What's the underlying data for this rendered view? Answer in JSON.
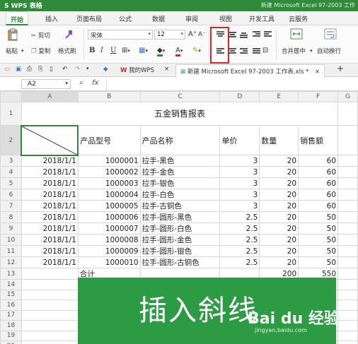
{
  "window": {
    "app_label": "S WPS 表格",
    "doc_title": "新建 Microsoft Excel 97-2003 工作"
  },
  "ribbon_tabs": [
    "开始",
    "插入",
    "页面布局",
    "公式",
    "数据",
    "审阅",
    "视图",
    "开发工具",
    "云服务"
  ],
  "ribbon": {
    "paste": "粘贴",
    "cut": "剪切",
    "copy": "复制",
    "format_painter": "格式刷",
    "font_name": "宋体",
    "font_size": "12",
    "merge_center": "合并居中",
    "wrap_text": "自动换行"
  },
  "doc_tabs": {
    "home": "我的WPS",
    "active": "新建 Microsoft Excel 97-2003 工作表.xls *"
  },
  "formula_bar": {
    "name_box": "A2",
    "fx": "fx"
  },
  "columns": [
    "A",
    "B",
    "C",
    "D",
    "E",
    "F"
  ],
  "sheet": {
    "title": "五金销售报表",
    "headers": [
      "产品型号",
      "产品名称",
      "单价",
      "数量",
      "销售额"
    ],
    "rows": [
      [
        "2018/1/1",
        "1000001",
        "拉手-黑色",
        "3",
        "20",
        "60"
      ],
      [
        "2018/1/1",
        "1000002",
        "拉手-金色",
        "3",
        "20",
        "60"
      ],
      [
        "2018/1/1",
        "1000003",
        "拉手-银色",
        "3",
        "20",
        "60"
      ],
      [
        "2018/1/1",
        "1000004",
        "拉手-白色",
        "3",
        "20",
        "60"
      ],
      [
        "2018/1/1",
        "1000005",
        "拉手-古铜色",
        "3",
        "20",
        "60"
      ],
      [
        "2018/1/1",
        "1000006",
        "拉手-圆形-黑色",
        "2.5",
        "20",
        "50"
      ],
      [
        "2018/1/1",
        "1000007",
        "拉手-圆形-白色",
        "2.5",
        "20",
        "50"
      ],
      [
        "2018/1/1",
        "1000008",
        "拉手-圆形-金色",
        "2.5",
        "20",
        "50"
      ],
      [
        "2018/1/1",
        "1000009",
        "拉手-圆形-银色",
        "2.5",
        "20",
        "50"
      ],
      [
        "2018/1/1",
        "1000010",
        "拉手-圆形-古铜色",
        "2.5",
        "20",
        "50"
      ]
    ],
    "total_label": "合计",
    "total_qty": "200",
    "total_sales": "550"
  },
  "row_numbers": [
    "1",
    "2",
    "3",
    "4",
    "5",
    "6",
    "7",
    "8",
    "9",
    "10",
    "11",
    "12",
    "13",
    "14",
    "15",
    "16",
    "17",
    "18",
    "19",
    "20"
  ],
  "banner": {
    "text": "插入斜线",
    "watermark": "Bai du 经验",
    "watermark_url": "jingyan.baidu.com"
  },
  "colors": {
    "accent": "#2f8a3a",
    "banner": "#2d9b43",
    "highlight": "#dd2222"
  }
}
